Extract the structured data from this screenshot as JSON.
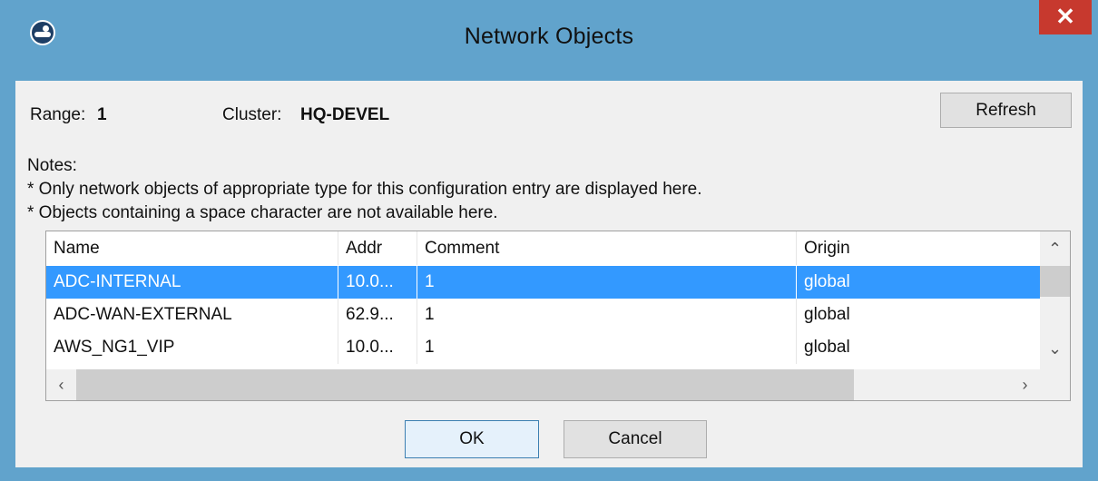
{
  "window": {
    "title": "Network Objects",
    "close_label": "✕"
  },
  "info": {
    "range_label": "Range:",
    "range_value": "1",
    "cluster_label": "Cluster:",
    "cluster_value": "HQ-DEVEL"
  },
  "refresh_label": "Refresh",
  "notes": {
    "heading": "Notes:",
    "line1": "* Only network objects of appropriate type for this configuration entry are displayed here.",
    "line2": "* Objects containing a space character are not available here."
  },
  "table": {
    "columns": [
      "Name",
      "Addr",
      "Comment",
      "Origin"
    ],
    "rows": [
      {
        "name": "ADC-INTERNAL",
        "addr": "10.0...",
        "comment": "1",
        "origin": "global",
        "selected": true
      },
      {
        "name": "ADC-WAN-EXTERNAL",
        "addr": "62.9...",
        "comment": "1",
        "origin": "global",
        "selected": false
      },
      {
        "name": "AWS_NG1_VIP",
        "addr": "10.0...",
        "comment": "1",
        "origin": "global",
        "selected": false
      }
    ],
    "scroll_icons": {
      "up": "chevron-up-icon",
      "down": "chevron-down-icon",
      "left": "chevron-left-icon",
      "right": "chevron-right-icon"
    }
  },
  "buttons": {
    "ok": "OK",
    "cancel": "Cancel"
  },
  "colors": {
    "titlebar": "#61a3cc",
    "close": "#c7392e",
    "selection": "#3399ff"
  }
}
